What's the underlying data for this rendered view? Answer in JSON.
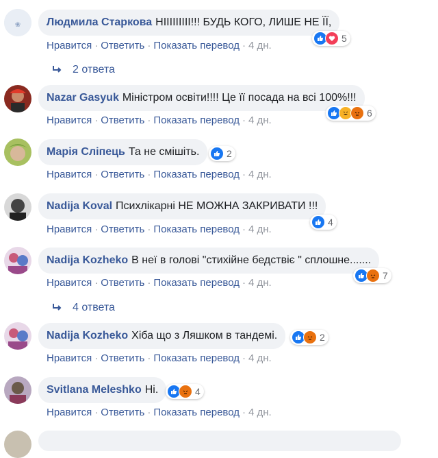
{
  "comments": [
    {
      "author": "Людмила Старкова",
      "text": "НІІІІІІІІІ!!! БУДЬ КОГО, ЛИШЕ НЕ ЇЇ,",
      "reaction_count": "5",
      "reactions": [
        "like",
        "love"
      ]
    },
    {
      "author": "Nazar Gasyuk",
      "text": "Міністром освіти!!!! Це її посада на всі 100%!!!",
      "reaction_count": "6",
      "reactions": [
        "like",
        "haha",
        "angry"
      ]
    },
    {
      "author": "Марія Сліпець",
      "text": "Та не смішіть.",
      "reaction_count": "2",
      "reactions": [
        "like"
      ]
    },
    {
      "author": "Nadija Koval",
      "text": "Психлікарні НЕ МОЖНА ЗАКРИВАТИ !!!",
      "reaction_count": "4",
      "reactions": [
        "like"
      ]
    },
    {
      "author": "Nadija Kozheko",
      "text": "В неї в голові \"стихійне бедствіє \" сплошне.......",
      "reaction_count": "7",
      "reactions": [
        "like",
        "angry"
      ]
    },
    {
      "author": "Nadija Kozheko",
      "text": "Хіба що з Ляшком в тандемі.",
      "reaction_count": "2",
      "reactions": [
        "like",
        "angry"
      ]
    },
    {
      "author": "Svitlana Meleshko",
      "text": "Ні.",
      "reaction_count": "4",
      "reactions": [
        "like",
        "angry"
      ]
    }
  ],
  "actions": {
    "like": "Нравится",
    "reply": "Ответить",
    "translate": "Показать перевод",
    "time": "4 дн.",
    "separator": "·"
  },
  "replies": [
    {
      "label": "2 ответа"
    },
    {
      "label": "4 ответа"
    }
  ],
  "colors": {
    "link": "#385898",
    "meta": "#90949c",
    "bubble": "#f0f2f5",
    "like": "#1877f2",
    "love": "#f33e58",
    "angry": "#e9710f",
    "haha": "#f7b125"
  }
}
